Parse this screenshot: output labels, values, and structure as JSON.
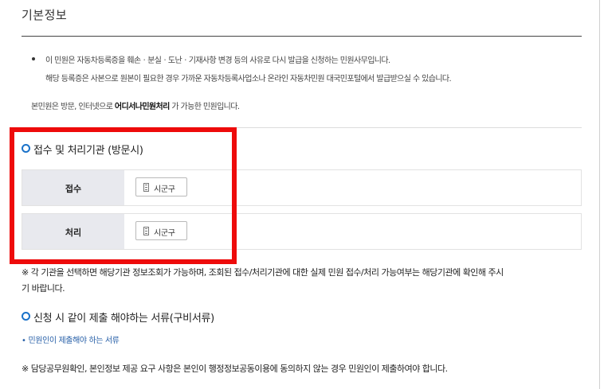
{
  "header": {
    "title": "기본정보"
  },
  "description": {
    "line1": "이 민원은 자동차등록증을 훼손ㆍ분실ㆍ도난ㆍ기재사항 변경 등의 사유로 다시 발급을 신청하는 민원사무입니다.",
    "line2": "해당 등록증은 사본으로 원본이 필요한 경우 가까운 자동차등록사업소나 온라인 자동차민원 대국민포털에서 발급받으실 수 있습니다.",
    "line3_prefix": "본민원은 방문, 인터넷으로 ",
    "line3_bold": "어디서나민원처리",
    "line3_suffix": " 가 가능한 민원입니다."
  },
  "agency_section": {
    "heading": "접수 및 처리기관 (방문시)",
    "rows": [
      {
        "label": "접수",
        "button_label": "시군구",
        "icon": "building-icon"
      },
      {
        "label": "처리",
        "button_label": "시군구",
        "icon": "building-icon"
      }
    ]
  },
  "notice1": {
    "line1": "※ 각 기관을 선택하면 해당기관 정보조회가 가능하며, 조회된 접수/처리기관에 대한 실제 민원 접수/처리 가능여부는 해당기관에 확인해 주시",
    "line2": "기 바랍니다."
  },
  "documents_section": {
    "heading": "신청 시 같이 제출 해야하는 서류(구비서류)",
    "link_bullet": "•",
    "link_label": "민원인이 제출해야 하는 서류"
  },
  "notice2": "※ 담당공무원확인, 본인정보 제공 요구 사항은 본인이 행정정보공동이용에 동의하지 않는 경우 민원인이 제출하여야 합니다.",
  "colors": {
    "highlight": "#ee0b0b",
    "accent_blue": "#1a72c9",
    "link": "#2860a8",
    "label_bg": "#e8e9ee"
  }
}
